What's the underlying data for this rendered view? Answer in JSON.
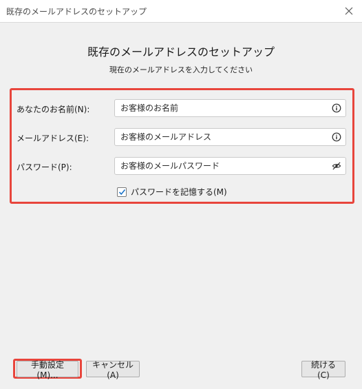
{
  "window": {
    "title": "既存のメールアドレスのセットアップ",
    "close_icon": "close-icon"
  },
  "heading": "既存のメールアドレスのセットアップ",
  "subheading": "現在のメールアドレスを入力してください",
  "form": {
    "name": {
      "label": "あなたのお名前(N):",
      "placeholder": "お客様のお名前",
      "icon": "info-icon"
    },
    "email": {
      "label": "メールアドレス(E):",
      "placeholder": "お客様のメールアドレス",
      "icon": "info-icon"
    },
    "password": {
      "label": "パスワード(P):",
      "placeholder": "お客様のメールパスワード",
      "icon": "eye-slash-icon"
    },
    "remember": {
      "label": "パスワードを記憶する(M)",
      "checked": true
    }
  },
  "buttons": {
    "manual": "手動設定(M)...",
    "cancel": "キャンセル(A)",
    "continue": "続ける(C)"
  },
  "colors": {
    "highlight": "#e8453c",
    "background": "#f0f0f0",
    "check_accent": "#1a73c8"
  }
}
